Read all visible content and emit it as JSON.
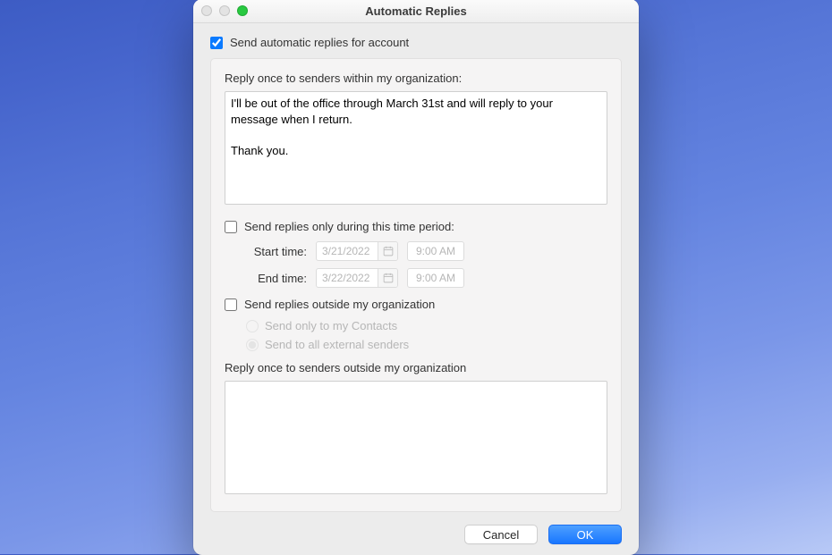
{
  "window": {
    "title": "Automatic Replies"
  },
  "main": {
    "enable_label": "Send automatic replies for account",
    "enable_checked": true
  },
  "internal": {
    "label": "Reply once to senders within my organization:",
    "message": "I'll be out of the office through March 31st and will reply to your message when I return.\n\nThank you."
  },
  "time": {
    "enable_label": "Send replies only during this time period:",
    "enable_checked": false,
    "start_label": "Start time:",
    "end_label": "End time:",
    "start_date": "3/21/2022",
    "start_time": "9:00 AM",
    "end_date": "3/22/2022",
    "end_time": "9:00 AM"
  },
  "external": {
    "enable_label": "Send replies outside my organization",
    "enable_checked": false,
    "radio_contacts": "Send only to my Contacts",
    "radio_all": "Send to all external senders",
    "label": "Reply once to senders outside my organization",
    "message": ""
  },
  "footer": {
    "cancel": "Cancel",
    "ok": "OK"
  }
}
